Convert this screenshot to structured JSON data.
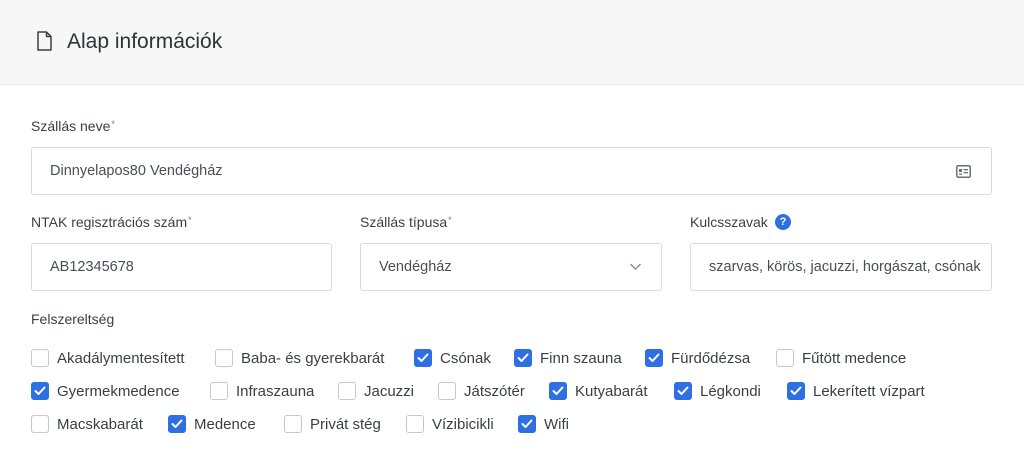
{
  "header": {
    "title": "Alap információk",
    "icon": "document-icon"
  },
  "fields": {
    "name": {
      "label": "Szállás neve",
      "value": "Dinnyelapos80 Vendégház",
      "icon": "id-card-icon"
    },
    "ntak": {
      "label": "NTAK regisztrációs szám",
      "value": "AB12345678"
    },
    "type": {
      "label": "Szállás típusa",
      "value": "Vendégház",
      "icon": "chevron-down-icon"
    },
    "keywords": {
      "label": "Kulcsszavak",
      "value": "szarvas, körös, jacuzzi, horgászat, csónak",
      "help": "?"
    }
  },
  "amenities": {
    "label": "Felszereltség",
    "items": [
      {
        "label": "Akadálymentesített",
        "checked": false
      },
      {
        "label": "Baba- és gyerekbarát",
        "checked": false
      },
      {
        "label": "Csónak",
        "checked": true
      },
      {
        "label": "Finn szauna",
        "checked": true
      },
      {
        "label": "Fürdődézsa",
        "checked": true
      },
      {
        "label": "Fűtött medence",
        "checked": false
      },
      {
        "label": "Gyermekmedence",
        "checked": true
      },
      {
        "label": "Infraszauna",
        "checked": false
      },
      {
        "label": "Jacuzzi",
        "checked": false
      },
      {
        "label": "Játszótér",
        "checked": false
      },
      {
        "label": "Kutyabarát",
        "checked": true
      },
      {
        "label": "Légkondi",
        "checked": true
      },
      {
        "label": "Lekerített vízpart",
        "checked": true
      },
      {
        "label": "Macskabarát",
        "checked": false
      },
      {
        "label": "Medence",
        "checked": true
      },
      {
        "label": "Privát stég",
        "checked": false
      },
      {
        "label": "Vízibicikli",
        "checked": false
      },
      {
        "label": "Wifi",
        "checked": true
      }
    ]
  },
  "colors": {
    "accent": "#2f6fe4",
    "header_bg": "#f7f7f7",
    "border": "#d8dade"
  }
}
